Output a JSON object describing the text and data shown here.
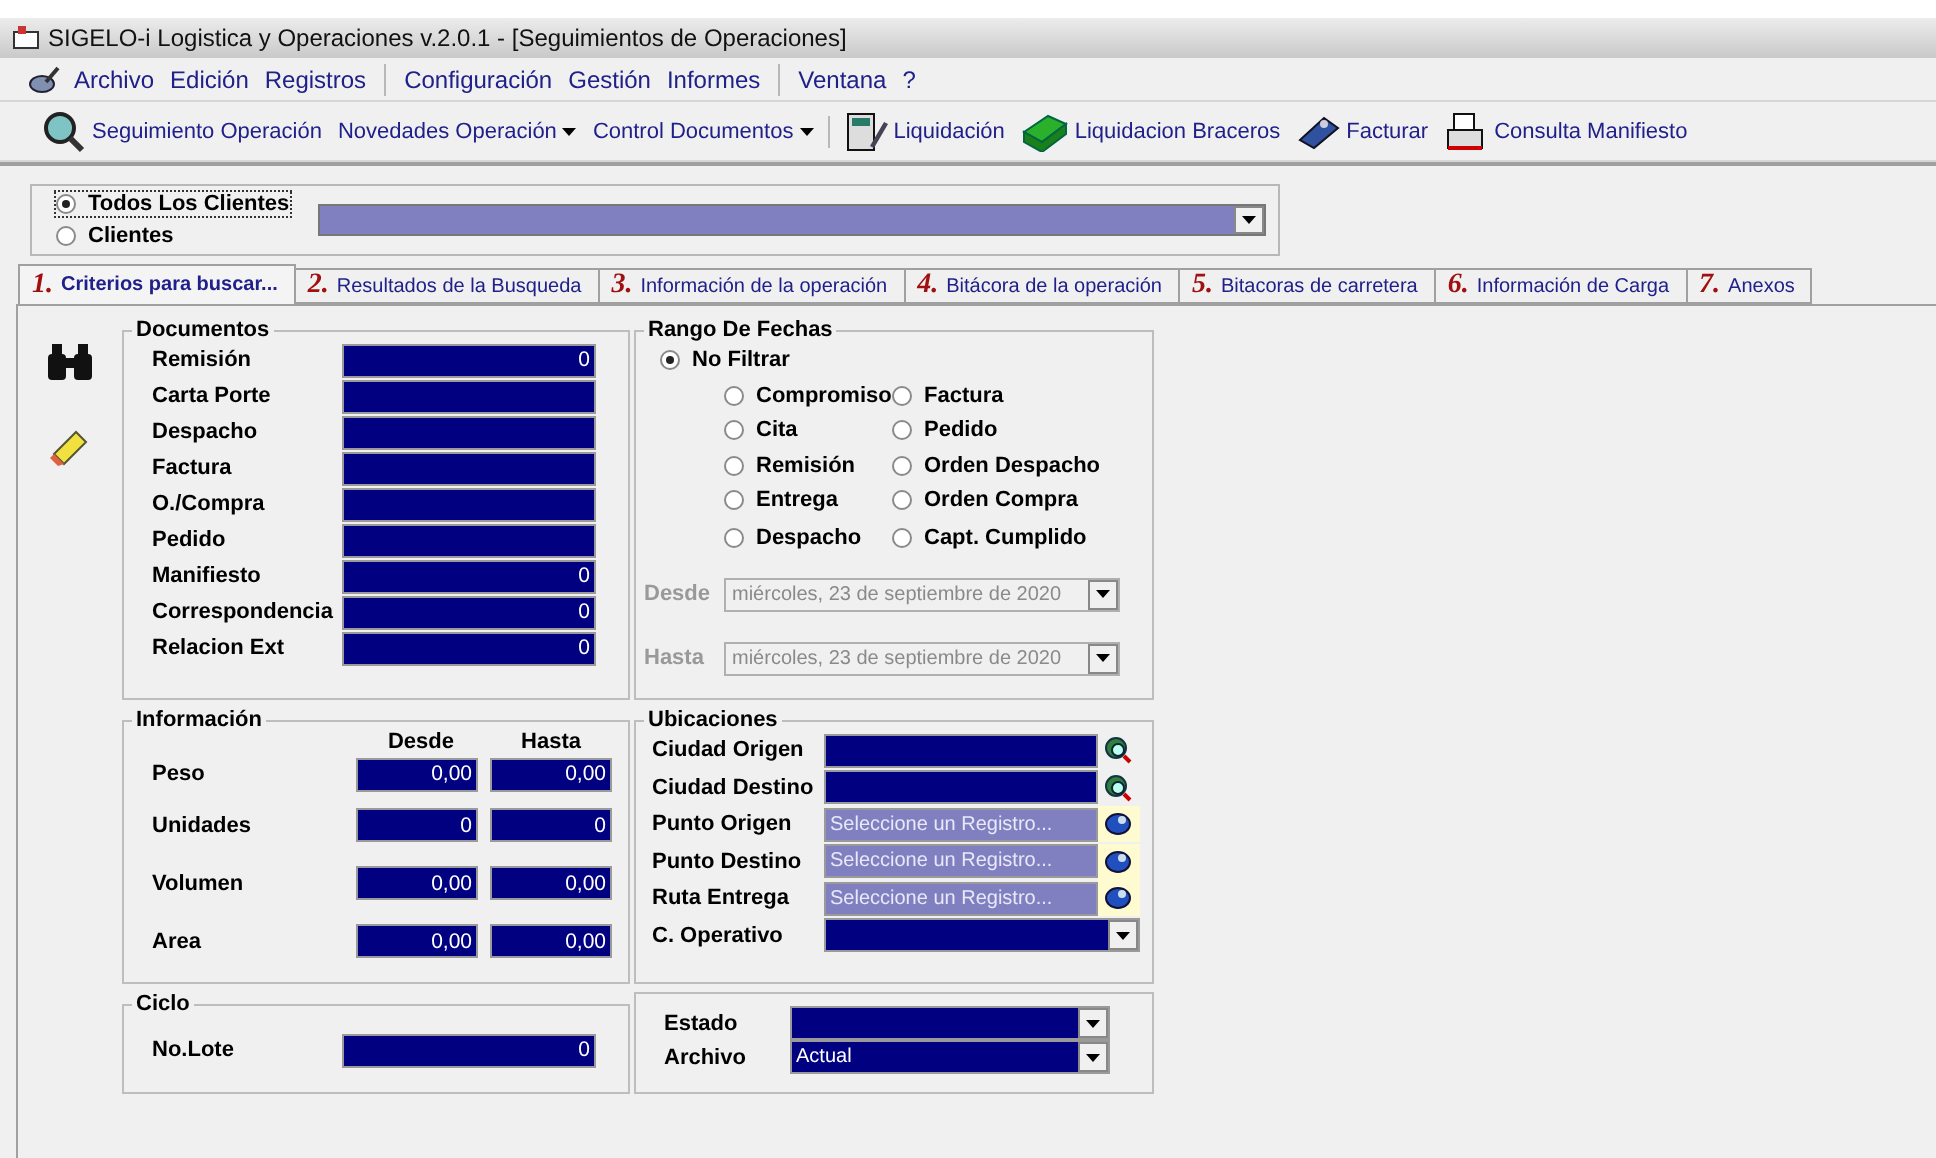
{
  "window": {
    "title": "SIGELO-i Logistica  y Operaciones v.2.0.1 - [Seguimientos de Operaciones]"
  },
  "menu_groups": [
    [
      "Archivo",
      "Edición",
      "Registros"
    ],
    [
      "Configuración",
      "Gestión",
      "Informes"
    ],
    [
      "Ventana",
      "?"
    ]
  ],
  "toolbar": [
    {
      "label": "Seguimiento Operación",
      "dropdown": false
    },
    {
      "label": "Novedades Operación",
      "dropdown": true
    },
    {
      "label": "Control Documentos",
      "dropdown": true
    },
    {
      "label": "Liquidación",
      "dropdown": false
    },
    {
      "label": "Liquidacion Braceros",
      "dropdown": false
    },
    {
      "label": "Facturar",
      "dropdown": false
    },
    {
      "label": "Consulta Manifiesto",
      "dropdown": false
    }
  ],
  "clients": {
    "options": [
      {
        "label": "Todos Los Clientes",
        "selected": true
      },
      {
        "label": "Clientes",
        "selected": false
      }
    ]
  },
  "tabs": [
    {
      "number": "1.",
      "label": "Criterios para buscar...",
      "selected": true
    },
    {
      "number": "2.",
      "label": "Resultados de la Busqueda",
      "selected": false
    },
    {
      "number": "3.",
      "label": "Información de la operación",
      "selected": false
    },
    {
      "number": "4.",
      "label": "Bitácora de la operación",
      "selected": false
    },
    {
      "number": "5.",
      "label": "Bitacoras de carretera",
      "selected": false
    },
    {
      "number": "6.",
      "label": "Información de Carga",
      "selected": false
    },
    {
      "number": "7.",
      "label": "Anexos",
      "selected": false
    }
  ],
  "documentos": {
    "title": "Documentos",
    "fields": [
      {
        "label": "Remisión",
        "value": "0"
      },
      {
        "label": "Carta Porte"
      },
      {
        "label": "Despacho"
      },
      {
        "label": "Factura"
      },
      {
        "label": "O./Compra"
      },
      {
        "label": "Pedido"
      },
      {
        "label": "Manifiesto",
        "value": "0"
      },
      {
        "label": "Correspondencia",
        "value": "0"
      },
      {
        "label": "Relacion Ext",
        "value": "0"
      }
    ]
  },
  "rango": {
    "title": "Rango De Fechas",
    "no_filtrar": {
      "label": "No Filtrar",
      "selected": true
    },
    "options": [
      {
        "label": "Compromiso",
        "selected": false
      },
      {
        "label": "Factura",
        "selected": false
      },
      {
        "label": "Cita",
        "selected": false
      },
      {
        "label": "Pedido",
        "selected": false
      },
      {
        "label": "Remisión",
        "selected": false
      },
      {
        "label": "Orden Despacho",
        "selected": false
      },
      {
        "label": "Entrega",
        "selected": false
      },
      {
        "label": "Orden Compra",
        "selected": false
      },
      {
        "label": "Despacho",
        "selected": false
      },
      {
        "label": "Capt. Cumplido",
        "selected": false
      }
    ],
    "dates": [
      {
        "label": "Desde",
        "value": "miércoles, 23 de septiembre de 2020",
        "disabled": true
      },
      {
        "label": "Hasta",
        "value": "miércoles, 23 de septiembre de 2020",
        "disabled": true
      }
    ]
  },
  "informacion": {
    "title": "Información",
    "columns": [
      "Desde",
      "Hasta"
    ],
    "rows": [
      {
        "label": "Peso",
        "desde": "0,00",
        "hasta": "0,00"
      },
      {
        "label": "Unidades",
        "desde": "0",
        "hasta": "0"
      },
      {
        "label": "Volumen",
        "desde": "0,00",
        "hasta": "0,00"
      },
      {
        "label": "Area",
        "desde": "0,00",
        "hasta": "0,00"
      }
    ]
  },
  "ubicaciones": {
    "title": "Ubicaciones",
    "rows": [
      {
        "label": "Ciudad Origen",
        "kind": "city"
      },
      {
        "label": "Ciudad Destino",
        "kind": "city"
      },
      {
        "label": "Punto Origen",
        "kind": "point",
        "placeholder": "Seleccione un Registro..."
      },
      {
        "label": "Punto Destino",
        "kind": "point",
        "placeholder": "Seleccione un Registro..."
      },
      {
        "label": "Ruta Entrega",
        "kind": "point",
        "placeholder": "Seleccione un Registro..."
      },
      {
        "label": "C. Operativo",
        "kind": "dropdown"
      }
    ]
  },
  "ciclo": {
    "title": "Ciclo",
    "fields": [
      {
        "label": "No.Lote",
        "value": "0"
      }
    ]
  },
  "estado": {
    "fields": [
      {
        "label": "Estado"
      },
      {
        "label": "Archivo",
        "value": "Actual"
      }
    ]
  }
}
